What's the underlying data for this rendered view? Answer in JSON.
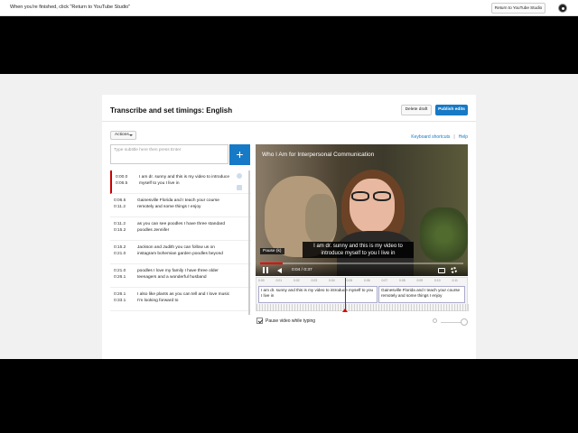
{
  "topbar": {
    "message": "When you're finished, click \"Return to YouTube Studio\"",
    "return_label": "Return to YouTube Studio"
  },
  "header": {
    "title": "Transcribe and set timings: English",
    "delete_label": "Delete draft",
    "publish_label": "Publish edits"
  },
  "toolbar": {
    "actions_label": "Actions",
    "shortcuts_label": "Keyboard shortcuts",
    "separator": "|",
    "help_label": "Help"
  },
  "input": {
    "placeholder": "Type subtitle here then press Enter",
    "add_label": "+"
  },
  "subtitles": [
    {
      "start": "0:00.0",
      "end": "0:06.5",
      "text": "I am dr. sunny and this is my video to introduce myself to you I live in"
    },
    {
      "start": "0:06.5",
      "end": "0:11.2",
      "text": "Gainesville Florida and I teach your course remotely and some things I enjoy"
    },
    {
      "start": "0:11.2",
      "end": "0:15.2",
      "text": "as you can see poodles I have three standard poodles Jennifer"
    },
    {
      "start": "0:15.2",
      "end": "0:21.0",
      "text": "Jackson and Judith you can follow us on instagram bohemian garden poodles beyond"
    },
    {
      "start": "0:21.0",
      "end": "0:26.1",
      "text": "poodles I love my family I have three older teenagers and a wonderful husband"
    },
    {
      "start": "0:26.1",
      "end": "0:33.1",
      "text": "I also like plants as you can tell and I love music I'm looking forward to"
    }
  ],
  "video": {
    "title": "Who I Am for Interpersonal Communication",
    "caption": "I am dr. sunny and this is my video to introduce myself to you I live in",
    "pause_tooltip": "Pause (k)",
    "time": "0:04 / 0:37",
    "progress": 0.11
  },
  "timeline": {
    "ticks": [
      "0:00",
      "0:01",
      "0:02",
      "0:03",
      "0:04",
      "0:05",
      "0:06",
      "0:07",
      "0:08",
      "0:09",
      "0:10",
      "0:11"
    ],
    "segments": [
      "I am dr. sunny and this is my video to introduce myself to you I live in",
      "Gainesville Florida and I teach your course remotely and some things I enjoy"
    ]
  },
  "options": {
    "pause_while_typing": "Pause video while typing",
    "pause_checked": true
  },
  "colors": {
    "accent": "#167ac6",
    "active_marker": "#cc0000"
  }
}
